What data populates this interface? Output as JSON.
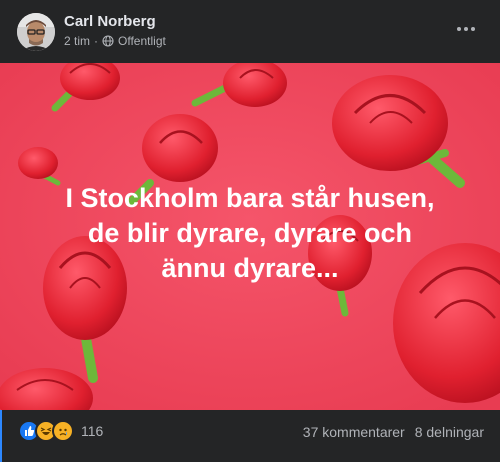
{
  "post": {
    "author": "Carl Norberg",
    "time": "2 tim",
    "separator": "·",
    "audience": "Offentligt",
    "text_lines": [
      "I Stockholm bara står husen,",
      "de blir dyrare, dyrare och",
      "ännu dyrare..."
    ],
    "background_color": "#f24a5e"
  },
  "footer": {
    "reaction_icons": [
      "like-icon",
      "haha-icon",
      "sad-icon"
    ],
    "reaction_count": "116",
    "comments": "37 kommentarer",
    "shares": "8 delningar"
  },
  "colors": {
    "card": "#242526",
    "text_primary": "#e4e6eb",
    "text_secondary": "#b0b3b8",
    "like_blue": "#1877f2",
    "accent": "#2d88ff",
    "rose_red": "#e8233a",
    "stem_green": "#6db83a"
  }
}
